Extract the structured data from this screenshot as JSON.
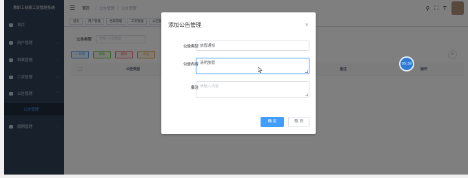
{
  "sidebar": {
    "title": "教职工档案工资管理系统",
    "items": [
      {
        "label": "首页",
        "icon": "dashboard-icon"
      },
      {
        "label": "用户管理",
        "icon": "user-icon"
      },
      {
        "label": "档案管理",
        "icon": "archive-icon"
      },
      {
        "label": "工资管理",
        "icon": "salary-icon"
      },
      {
        "label": "公告管理",
        "icon": "notice-icon"
      },
      {
        "label": "假期管理",
        "icon": "leave-icon"
      }
    ],
    "active_sub": "公告管理"
  },
  "header": {
    "breadcrumb": [
      "首页",
      "公告管理",
      "公告管理"
    ]
  },
  "tags": [
    "首页",
    "用户管理",
    "档案管理",
    "工资管理",
    "公告管理"
  ],
  "search": {
    "label": "公告类型",
    "placeholder": "请输入公告类型"
  },
  "toolbar": {
    "add": "+ 新增",
    "edit": "修改",
    "delete": "删除",
    "export": "导出"
  },
  "table": {
    "headers": [
      "公告类型",
      "备注",
      "操作"
    ]
  },
  "dialog": {
    "title": "添加公告管理",
    "close": "×",
    "fields": [
      {
        "label": "公告类型",
        "value": "放假通知",
        "placeholder": ""
      },
      {
        "label": "公告内容",
        "value": "清明放假",
        "placeholder": ""
      },
      {
        "label": "备注",
        "value": "",
        "placeholder": "请输入内容"
      }
    ],
    "confirm": "确 定",
    "cancel": "取 消"
  },
  "time_badge": "05:39",
  "colors": {
    "primary": "#409eff",
    "sidebar_bg": "#304156",
    "sidebar_active": "#1f2d3d",
    "badge": "#2e7bd6"
  }
}
